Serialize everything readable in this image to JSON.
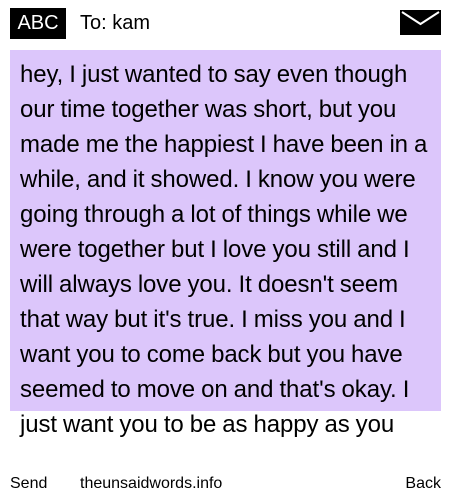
{
  "header": {
    "input_mode": "ABC",
    "to_label": "To:",
    "recipient": "kam",
    "envelope_icon": "envelope-icon"
  },
  "message": {
    "body": "hey, I just wanted to say even though our time together was short, but you made me the happiest I have been in a while, and it showed. I know you were going through a lot of things while we were together but I love you still and I will always love you. It doesn't seem that way but it's true. I miss you and I want you to come back but you have seemed to move on and that's okay. I just want you to be as happy as you"
  },
  "softkeys": {
    "left": "Send",
    "center": "theunsaidwords.info",
    "right": "Back"
  },
  "colors": {
    "message_background": "#dcc6fb",
    "badge_background": "#000000",
    "badge_text": "#ffffff"
  }
}
